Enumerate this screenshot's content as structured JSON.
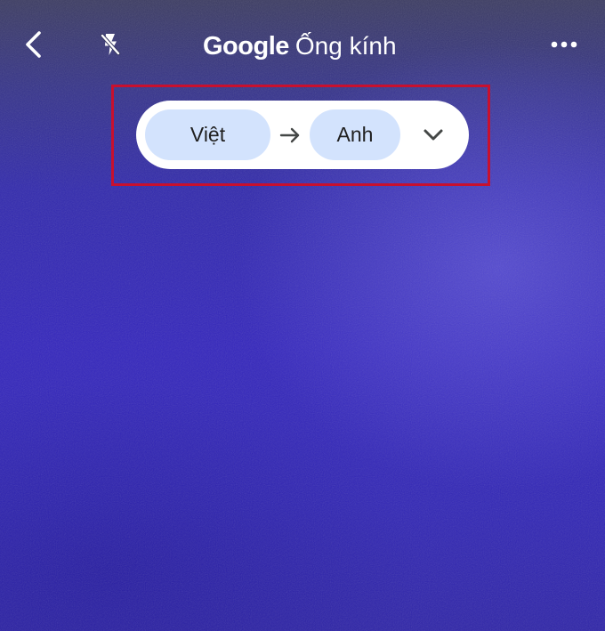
{
  "header": {
    "title_brand": "Google",
    "title_product": "Ống kính",
    "icons": {
      "back": "back-arrow-icon",
      "flash": "flash-off-icon",
      "more": "more-options-icon"
    }
  },
  "translate_bar": {
    "source_language": "Việt",
    "target_language": "Anh",
    "arrow_icon": "arrow-right-icon",
    "dropdown_icon": "chevron-down-icon",
    "chip_color": "#d3e3fd"
  },
  "annotation": {
    "highlight_color": "#c8102e"
  }
}
